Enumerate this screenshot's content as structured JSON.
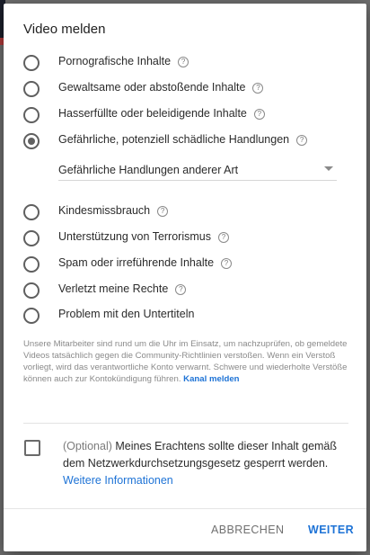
{
  "dialog": {
    "title": "Video melden",
    "options": [
      {
        "label": "Pornografische Inhalte",
        "help": "?",
        "checked": false
      },
      {
        "label": "Gewaltsame oder abstoßende Inhalte",
        "help": "?",
        "checked": false
      },
      {
        "label": "Hasserfüllte oder beleidigende Inhalte",
        "help": "?",
        "checked": false
      },
      {
        "label": "Gefährliche, potenziell schädliche Handlungen",
        "help": "?",
        "checked": true
      },
      {
        "label": "Kindesmissbrauch",
        "help": "?",
        "checked": false
      },
      {
        "label": "Unterstützung von Terrorismus",
        "help": "?",
        "checked": false
      },
      {
        "label": "Spam oder irreführende Inhalte",
        "help": "?",
        "checked": false
      },
      {
        "label": "Verletzt meine Rechte",
        "help": "?",
        "checked": false
      },
      {
        "label": "Problem mit den Untertiteln",
        "checked": false
      }
    ],
    "subcategory_select": {
      "value": "Gefährliche Handlungen anderer Art"
    },
    "info_text": "Unsere Mitarbeiter sind rund um die Uhr im Einsatz, um nachzuprüfen, ob gemeldete Videos tatsächlich gegen die Community-Richtlinien verstoßen. Wenn ein Verstoß vorliegt, wird das verantwortliche Konto verwarnt. Schwere und wiederholte Verstöße können auch zur Kontokündigung führen.",
    "info_link": "Kanal melden",
    "nzg": {
      "prefix": "(Optional)",
      "text": "Meines Erachtens sollte dieser Inhalt gemäß dem Netzwerkdurchsetzungsgesetz gesperrt werden.",
      "link": "Weitere Informationen",
      "checked": false
    },
    "buttons": {
      "cancel": "ABBRECHEN",
      "next": "WEITER"
    },
    "colors": {
      "accent": "#1e73d6",
      "text": "#212121",
      "muted": "#8a8a8a"
    }
  }
}
